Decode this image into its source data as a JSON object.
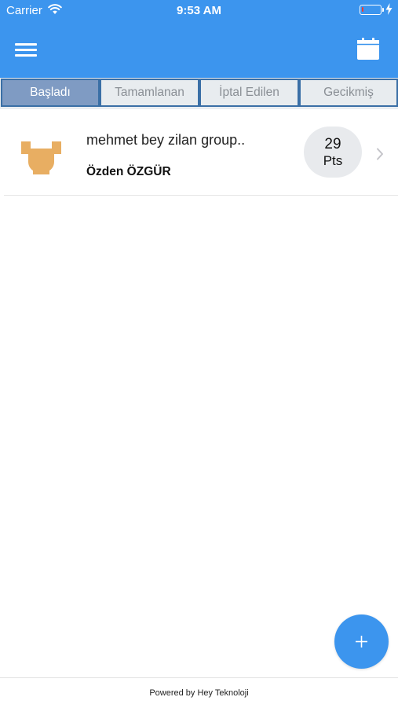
{
  "status_bar": {
    "carrier": "Carrier",
    "time": "9:53 AM",
    "battery_level_fraction": 0.1
  },
  "header": {
    "menu_icon": "hamburger-menu-icon",
    "calendar_icon": "calendar-icon"
  },
  "tabs": [
    {
      "label": "Başladı",
      "active": true
    },
    {
      "label": "Tamamlanan",
      "active": false
    },
    {
      "label": "İptal Edilen",
      "active": false
    },
    {
      "label": "Gecikmiş",
      "active": false
    }
  ],
  "list": [
    {
      "title": "mehmet bey zilan group..",
      "subtitle": "Özden ÖZGÜR",
      "points": "29",
      "points_label": "Pts",
      "logo_color": "#e8ae62"
    }
  ],
  "fab": {
    "icon": "plus-icon"
  },
  "footer": {
    "text": "Powered by Hey Teknoloji"
  },
  "colors": {
    "primary": "#3c95ee",
    "tab_active": "#7f9bc3",
    "tab_border": "#3a6fa6"
  }
}
